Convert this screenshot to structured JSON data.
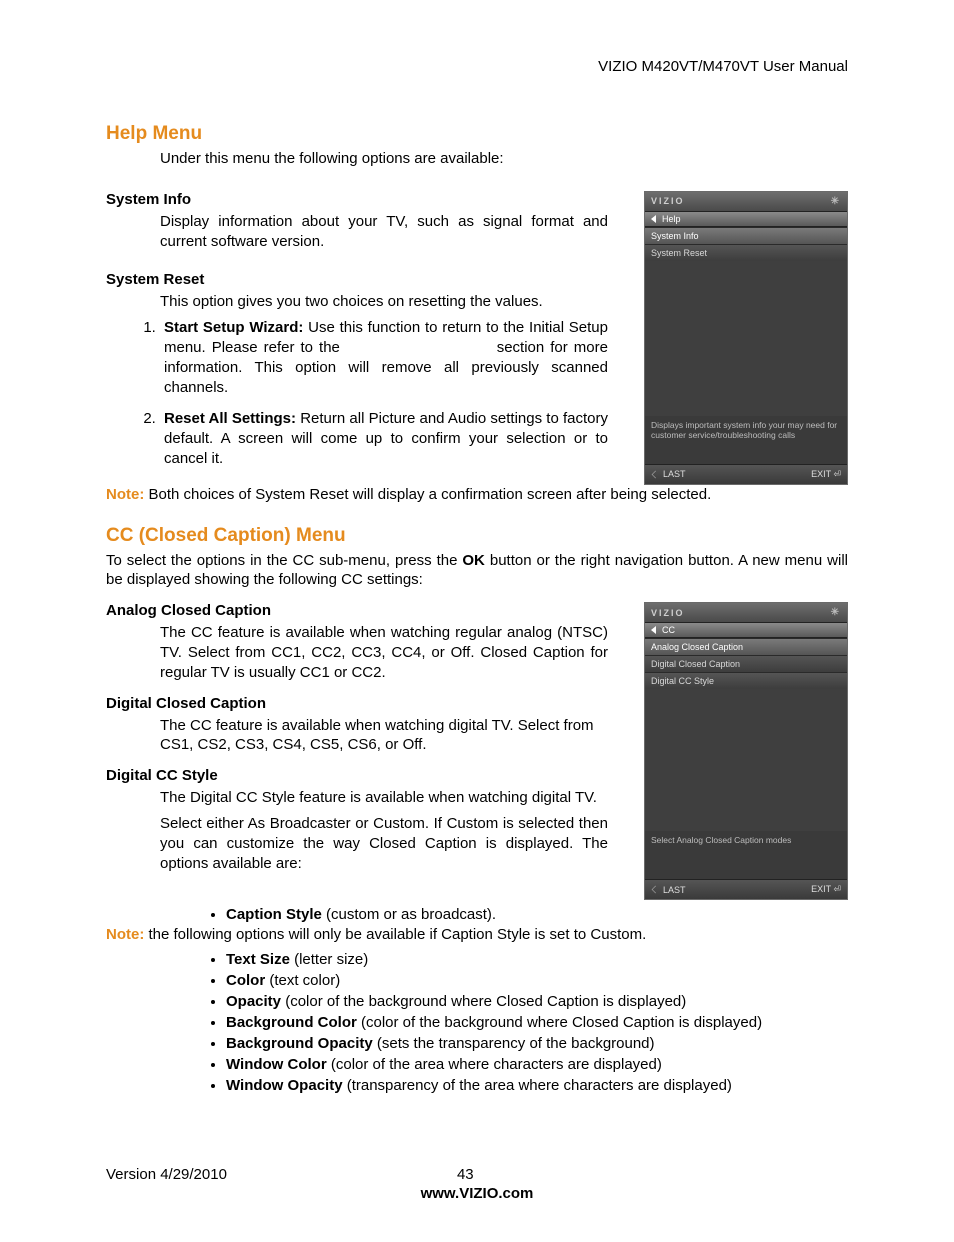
{
  "header": {
    "manual_title": "VIZIO M420VT/M470VT User Manual"
  },
  "help": {
    "heading": "Help Menu",
    "intro": "Under this menu the following options are available:",
    "system_info": {
      "label": "System Info",
      "text": "Display information about your TV, such as signal format and current software version."
    },
    "system_reset": {
      "label": "System Reset",
      "text": "This option gives you two choices on resetting the values.",
      "item1_label": "Start Setup Wizard:",
      "item1_text_a": " Use this function to return to the Initial Setup menu. Please refer to the ",
      "item1_text_b": " section for more information. This option will remove all previously scanned channels.",
      "item2_label": "Reset All Settings:",
      "item2_text": " Return all Picture and Audio settings to factory default. A screen will come up to confirm your selection or to cancel it."
    },
    "note_label": "Note:",
    "note_text": " Both choices of System Reset will display a confirmation screen after being selected."
  },
  "cc": {
    "heading": "CC (Closed Caption) Menu",
    "intro_a": "To select the options in the CC sub-menu, press the ",
    "intro_ok": "OK",
    "intro_b": " button or the right navigation button. A new menu will be displayed showing the following CC settings:",
    "analog": {
      "label": "Analog Closed Caption",
      "text": "The CC feature is available when watching regular analog (NTSC) TV. Select from CC1, CC2, CC3, CC4, or Off. Closed Caption for regular TV is usually CC1 or CC2."
    },
    "digital": {
      "label": "Digital Closed Caption",
      "text": "The CC feature is available when watching digital TV. Select from CS1, CS2, CS3, CS4, CS5, CS6, or Off."
    },
    "style": {
      "label": "Digital CC Style",
      "line1": "The Digital CC Style feature is available when watching digital TV.",
      "line2": "Select either As Broadcaster or Custom. If Custom is selected then you can customize the way Closed Caption is displayed. The options available are:",
      "b1_label": "Caption Style",
      "b1_text": " (custom or as broadcast).",
      "note_label": "Note:",
      "note_text": " the following options will only be available if Caption Style is set to Custom.",
      "b2_label": "Text Size",
      "b2_text": " (letter size)",
      "b3_label": "Color",
      "b3_text": " (text color)",
      "b4_label": "Opacity",
      "b4_text": " (color of the background where Closed Caption  is displayed)",
      "b5_label": "Background Color",
      "b5_text": " (color of the background where Closed Caption is displayed)",
      "b6_label": "Background Opacity",
      "b6_text": " (sets the transparency of the background)",
      "b7_label": "Window Color",
      "b7_text": " (color of the area where characters are displayed)",
      "b8_label": "Window Opacity",
      "b8_text": " (transparency of the area where characters are displayed)"
    }
  },
  "osd1": {
    "brand": "VIZIO",
    "tab": "Help",
    "items": [
      "System Info",
      "System Reset"
    ],
    "desc": "Displays important system info your may need for customer service/troubleshooting calls",
    "last": "LAST",
    "exit": "EXIT"
  },
  "osd2": {
    "brand": "VIZIO",
    "tab": "CC",
    "items": [
      "Analog Closed Caption",
      "Digital Closed Caption",
      "Digital CC Style"
    ],
    "desc": "Select Analog Closed Caption modes",
    "last": "LAST",
    "exit": "EXIT"
  },
  "footer": {
    "version": "Version 4/29/2010",
    "page": "43",
    "site": "www.VIZIO.com"
  }
}
